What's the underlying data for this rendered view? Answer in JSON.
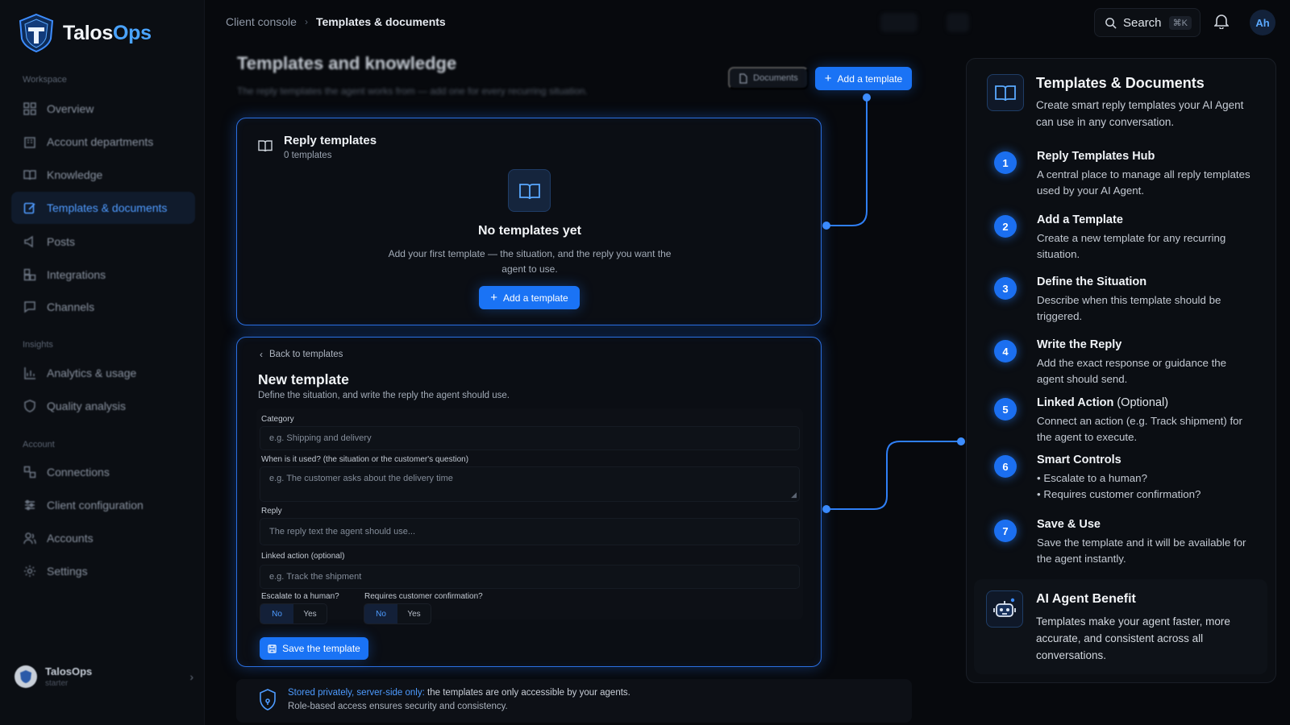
{
  "brand": {
    "name_part1": "Talos",
    "name_part2": "Ops"
  },
  "sidebar": {
    "sections": [
      "Workspace",
      "Insights",
      "Account"
    ],
    "items": [
      {
        "label": "Overview",
        "icon": "grid-icon"
      },
      {
        "label": "Account departments",
        "icon": "building-icon"
      },
      {
        "label": "Knowledge",
        "icon": "book-icon"
      },
      {
        "label": "Templates & documents",
        "icon": "edit-icon",
        "active": true
      },
      {
        "label": "Posts",
        "icon": "megaphone-icon"
      },
      {
        "label": "Integrations",
        "icon": "puzzle-icon"
      },
      {
        "label": "Channels",
        "icon": "chat-icon"
      },
      {
        "label": "Analytics & usage",
        "icon": "bar-chart-icon"
      },
      {
        "label": "Quality analysis",
        "icon": "shield-icon"
      },
      {
        "label": "Connections",
        "icon": "link-icon"
      },
      {
        "label": "Client configuration",
        "icon": "sliders-icon"
      },
      {
        "label": "Accounts",
        "icon": "users-icon"
      },
      {
        "label": "Settings",
        "icon": "gear-icon"
      }
    ],
    "workspace": {
      "name": "TalosOps",
      "plan": "starter"
    }
  },
  "topbar": {
    "breadcrumb": [
      "Client console",
      "Templates & documents"
    ],
    "search_label": "Search",
    "search_shortcut": "⌘K",
    "avatar_initials": "Ah"
  },
  "main": {
    "title": "Templates and knowledge",
    "subtitle": "The reply templates the agent works from — add one for every recurring situation.",
    "documents_button": "Documents",
    "add_template_button": "Add a template"
  },
  "reply_templates": {
    "title": "Reply templates",
    "count": "0 templates",
    "empty_title": "No templates yet",
    "empty_desc": "Add your first template — the situation, and the reply you want the agent to use.",
    "add_button": "Add a template"
  },
  "new_template": {
    "back_label": "Back to templates",
    "title": "New template",
    "subtitle": "Define the situation, and write the reply the agent should use.",
    "fields": {
      "category_label": "Category",
      "category_placeholder": "e.g. Shipping and delivery",
      "situation_label": "When is it used? (the situation or the customer's question)",
      "situation_placeholder": "e.g. The customer asks about the delivery time",
      "reply_label": "Reply",
      "reply_placeholder": "The reply text the agent should use...",
      "action_label": "Linked action (optional)",
      "action_placeholder": "e.g. Track the shipment"
    },
    "escalate": {
      "label": "Escalate to a human?",
      "no": "No",
      "yes": "Yes",
      "selected": "No"
    },
    "confirm": {
      "label": "Requires customer confirmation?",
      "no": "No",
      "yes": "Yes",
      "selected": "No"
    },
    "save_button": "Save the template"
  },
  "privacy": {
    "highlight": "Stored privately, server-side only:",
    "line1_rest": " the templates are only accessible by your agents.",
    "line2": "Role-based access ensures security and consistency."
  },
  "guide": {
    "title": "Templates & Documents",
    "subtitle": "Create smart reply templates your AI Agent can use in any conversation.",
    "steps": [
      {
        "num": "1",
        "title": "Reply Templates Hub",
        "desc": "A central place to manage all reply templates used by your AI Agent."
      },
      {
        "num": "2",
        "title": "Add a Template",
        "desc": "Create a new template for any recurring situation."
      },
      {
        "num": "3",
        "title": "Define the Situation",
        "desc": "Describe when this template should be triggered."
      },
      {
        "num": "4",
        "title": "Write the Reply",
        "desc": "Add the exact response or guidance the agent should send."
      },
      {
        "num": "5",
        "title": "Linked Action",
        "title_suffix": " (Optional)",
        "desc": "Connect an action (e.g. Track shipment) for the agent to execute."
      },
      {
        "num": "6",
        "title": "Smart Controls",
        "desc_lines": [
          "• Escalate to a human?",
          "• Requires customer confirmation?"
        ]
      },
      {
        "num": "7",
        "title": "Save & Use",
        "desc": "Save the template and it will be available for the agent instantly."
      }
    ],
    "benefit": {
      "title": "AI Agent Benefit",
      "desc": "Templates make your agent faster, more accurate, and consistent across all conversations."
    }
  },
  "colors": {
    "accent": "#1a73f5",
    "glow": "#2a6fe0",
    "background": "#07090d"
  }
}
